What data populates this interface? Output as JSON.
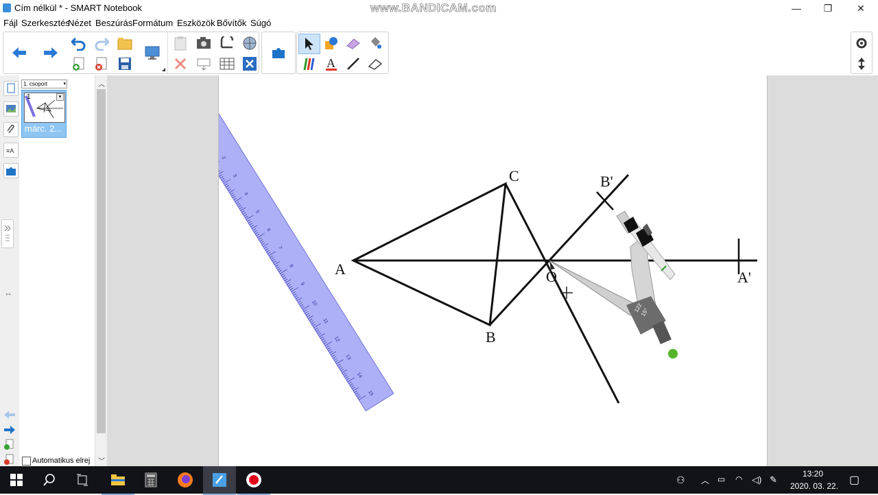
{
  "window": {
    "title": "Cím nélkül * - SMART Notebook",
    "watermark": "www.BANDICAM.com",
    "min_glyph": "—",
    "max_glyph": "❐",
    "close_glyph": "✕"
  },
  "menu": [
    "Fájl",
    "Szerkesztés",
    "Nézet",
    "Beszúrás",
    "Formátum",
    "Eszközök",
    "Bővítők",
    "Súgó"
  ],
  "sorter": {
    "group_select": "1. csoport",
    "page_number": "1",
    "page_label": "márc. 2...",
    "auto_hide_label": "Automatikus elrej"
  },
  "drawing": {
    "points": {
      "A": "A",
      "B": "B",
      "C": "C",
      "O": "O",
      "A_prime": "A'",
      "B_prime": "B'"
    }
  },
  "ruler": {
    "ticks": [
      "1",
      "2",
      "3",
      "4",
      "5",
      "6",
      "7",
      "8",
      "9",
      "10",
      "11",
      "12",
      "13",
      "14",
      "15"
    ]
  },
  "compass": {
    "angle_label": "15°",
    "value_label": "122"
  },
  "taskbar": {
    "time": "13:20",
    "date": "2020. 03. 22."
  },
  "colors": {
    "toolbar_blue": "#1f73c7",
    "ruler_fill": "#9a9cf5",
    "selected_tool_bg": "#cde3f7",
    "taskbar_bg": "#111318",
    "record_red": "#e3001b"
  }
}
